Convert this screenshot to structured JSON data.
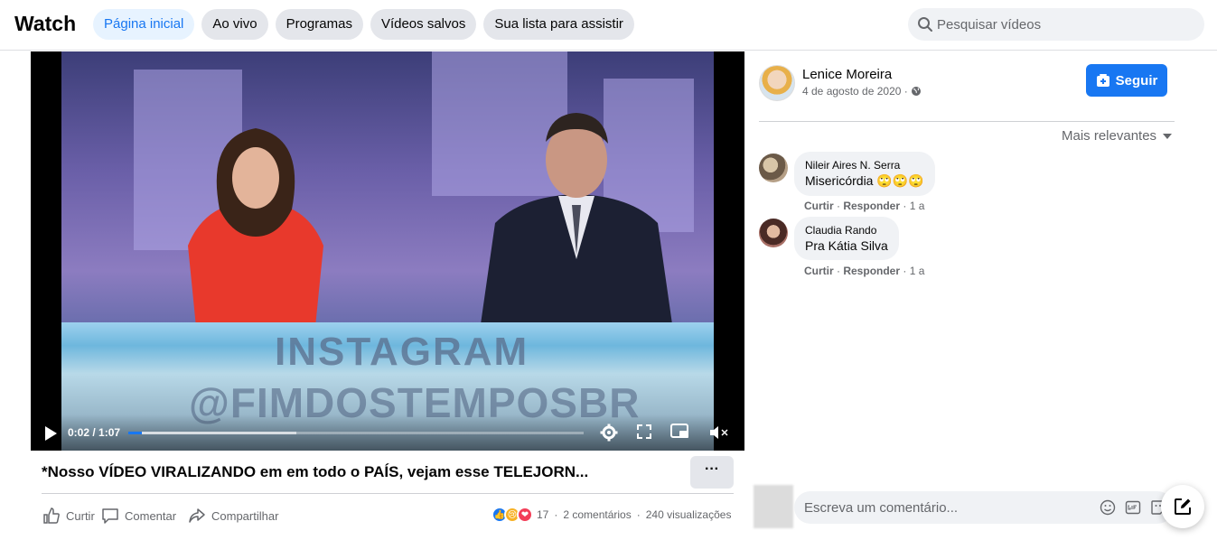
{
  "header": {
    "brand": "Watch",
    "tabs": [
      {
        "label": "Página inicial",
        "active": true
      },
      {
        "label": "Ao vivo",
        "active": false
      },
      {
        "label": "Programas",
        "active": false
      },
      {
        "label": "Vídeos salvos",
        "active": false
      },
      {
        "label": "Sua lista para assistir",
        "active": false
      }
    ],
    "search_placeholder": "Pesquisar vídeos"
  },
  "video": {
    "watermark_line1": "INSTAGRAM",
    "watermark_line2": "@FIMDOSTEMPOSBR",
    "current_time": "0:02",
    "duration": "1:07",
    "time_display": "0:02 / 1:07",
    "progress_fraction": 0.03,
    "buffer_fraction": 0.37,
    "muted": true
  },
  "post": {
    "title": "*Nosso VÍDEO VIRALIZANDO em em todo o PAÍS, vejam esse TELEJORN...",
    "more_label": "···",
    "actions": {
      "like": "Curtir",
      "comment": "Comentar",
      "share": "Compartilhar"
    },
    "reaction_count": "17",
    "comments_count": "2 comentários",
    "views": "240 visualizações",
    "separator": "·"
  },
  "author": {
    "name": "Lenice Moreira",
    "date": "4 de agosto de 2020 ·",
    "follow_label": "Seguir"
  },
  "comments_section": {
    "sort_label": "Mais relevantes",
    "comments": [
      {
        "name": "Nileir Aires N. Serra",
        "text": "Misericórdia 🙄🙄🙄",
        "like": "Curtir",
        "reply": "Responder",
        "age": "1 a"
      },
      {
        "name": "Claudia Rando",
        "text": "Pra Kátia Silva",
        "like": "Curtir",
        "reply": "Responder",
        "age": "1 a"
      }
    ],
    "composer_placeholder": "Escreva um comentário..."
  },
  "colors": {
    "accent": "#1877f2",
    "secondary_text": "#65676b",
    "surface": "#f0f2f5"
  }
}
